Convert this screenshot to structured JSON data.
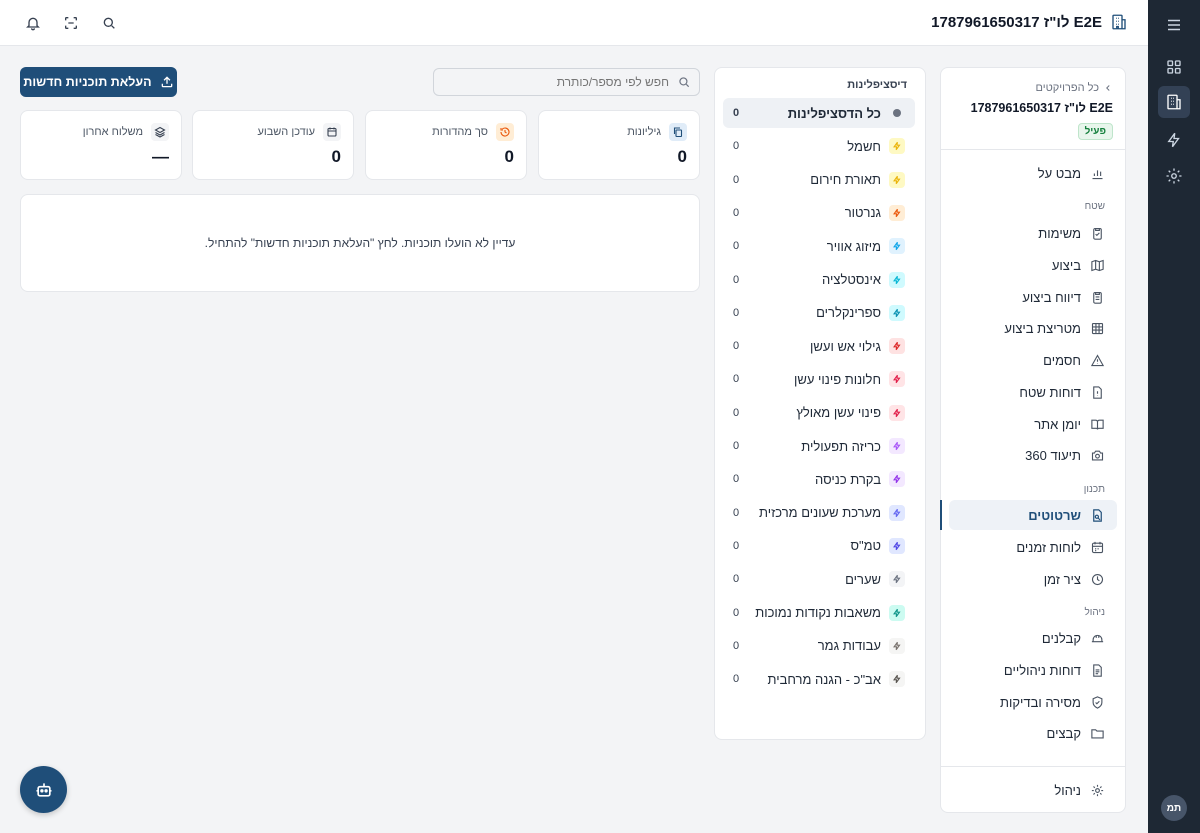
{
  "header": {
    "project_title": "E2E לו\"ז 1787961650317",
    "icons": [
      "bell-icon",
      "scan-icon",
      "search-icon"
    ]
  },
  "rail": {
    "items": [
      "menu-icon",
      "grid-icon",
      "building-icon",
      "bolt-icon",
      "settings-icon"
    ],
    "avatar": "תמ"
  },
  "nav": {
    "back_label": "כל הפרויקטים",
    "project_name": "E2E לו\"ז 1787961650317",
    "status_badge": "פעיל",
    "overview": "מבט על",
    "section_field": "שטח",
    "field_items": [
      "משימות",
      "ביצוע",
      "דיווח ביצוע",
      "מטריצת ביצוע",
      "חסמים",
      "דוחות שטח",
      "יומן אתר",
      "תיעוד 360"
    ],
    "section_planning": "תכנון",
    "planning_items": [
      "שרטוטים",
      "לוחות זמנים",
      "ציר זמן"
    ],
    "section_management": "ניהול",
    "management_items": [
      "קבלנים",
      "דוחות ניהוליים",
      "מסירה ובדיקות",
      "קבצים"
    ],
    "footer_item": "ניהול"
  },
  "disciplines": {
    "title": "דיסציפלינות",
    "items": [
      {
        "name": "כל הדסציפלינות",
        "count": "0",
        "color": "#6b7280",
        "bg": "#ffffff"
      },
      {
        "name": "חשמל",
        "count": "0",
        "color": "#eab308",
        "bg": "#fef9c3"
      },
      {
        "name": "תאורת חירום",
        "count": "0",
        "color": "#eab308",
        "bg": "#fef9c3"
      },
      {
        "name": "גנרטור",
        "count": "0",
        "color": "#ea580c",
        "bg": "#ffedd5"
      },
      {
        "name": "מיזוג אוויר",
        "count": "0",
        "color": "#0ea5e9",
        "bg": "#e0f2fe"
      },
      {
        "name": "אינסטלציה",
        "count": "0",
        "color": "#06b6d4",
        "bg": "#cffafe"
      },
      {
        "name": "ספרינקלרים",
        "count": "0",
        "color": "#0891b2",
        "bg": "#cffafe"
      },
      {
        "name": "גילוי אש ועשן",
        "count": "0",
        "color": "#dc2626",
        "bg": "#fee2e2"
      },
      {
        "name": "חלונות פינוי עשן",
        "count": "0",
        "color": "#e11d48",
        "bg": "#ffe4e6"
      },
      {
        "name": "פינוי עשן מאולץ",
        "count": "0",
        "color": "#e11d48",
        "bg": "#ffe4e6"
      },
      {
        "name": "כריזה תפעולית",
        "count": "0",
        "color": "#a855f7",
        "bg": "#f3e8ff"
      },
      {
        "name": "בקרת כניסה",
        "count": "0",
        "color": "#9333ea",
        "bg": "#f3e8ff"
      },
      {
        "name": "מערכת שעונים מרכזית",
        "count": "0",
        "color": "#6366f1",
        "bg": "#e0e7ff"
      },
      {
        "name": "טמ\"ס",
        "count": "0",
        "color": "#4f46e5",
        "bg": "#e0e7ff"
      },
      {
        "name": "שערים",
        "count": "0",
        "color": "#6b7280",
        "bg": "#f3f4f6"
      },
      {
        "name": "משאבות נקודות נמוכות",
        "count": "0",
        "color": "#0d9488",
        "bg": "#ccfbf1"
      },
      {
        "name": "עבודות גמר",
        "count": "0",
        "color": "#78716c",
        "bg": "#f5f5f4"
      },
      {
        "name": "אב\"כ - הגנה מרחבית",
        "count": "0",
        "color": "#57534e",
        "bg": "#f5f5f4"
      }
    ]
  },
  "search": {
    "placeholder": "חפש לפי מספר/כותרת"
  },
  "upload_button": "העלאת תוכניות חדשות",
  "stats": [
    {
      "label": "גיליונות",
      "value": "0",
      "icon": "copy-icon",
      "color": "#1f4e79",
      "bg": "#e0ecf8"
    },
    {
      "label": "סך מהדורות",
      "value": "0",
      "icon": "history-icon",
      "color": "#ea580c",
      "bg": "#ffedd5"
    },
    {
      "label": "עודכן השבוע",
      "value": "0",
      "icon": "calendar-icon",
      "color": "#374151",
      "bg": "#f3f4f6"
    },
    {
      "label": "משלוח אחרון",
      "value": "—",
      "icon": "layers-icon",
      "color": "#374151",
      "bg": "#f3f4f6"
    }
  ],
  "empty_message": "עדיין לא הועלו תוכניות. לחץ \"העלאת תוכניות חדשות\" להתחיל."
}
